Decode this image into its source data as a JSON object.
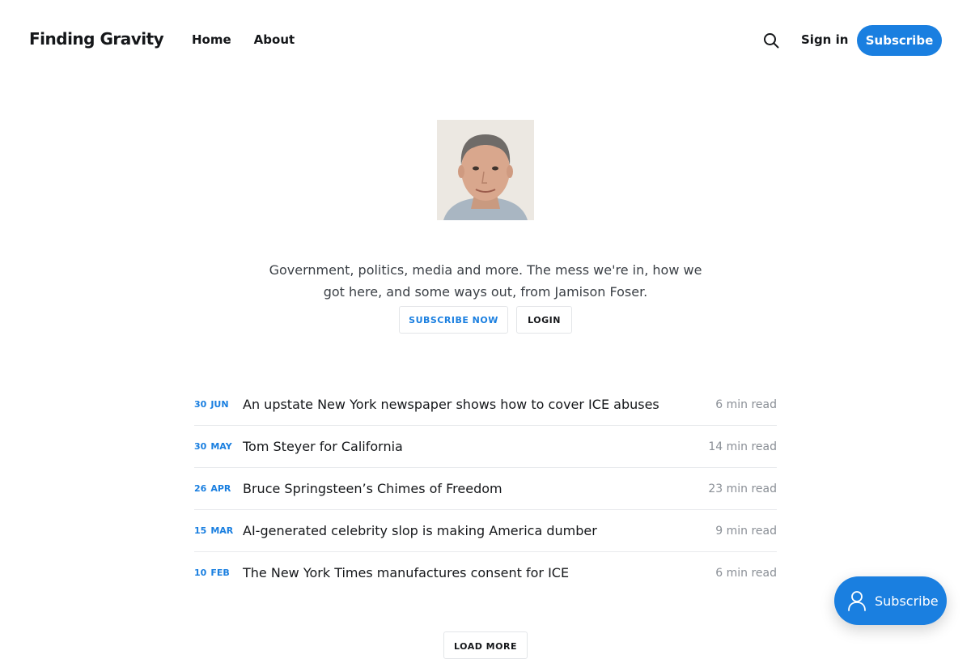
{
  "header": {
    "logo": "Finding Gravity",
    "nav": [
      {
        "label": "Home"
      },
      {
        "label": "About"
      }
    ],
    "search_icon": "search-icon",
    "signin_label": "Sign in",
    "subscribe_label": "Subscribe"
  },
  "hero": {
    "avatar": "author-photo",
    "description": "Government, politics, media and more. The mess we're in, how we got here, and some ways out, from Jamison Foser.",
    "subscribe_now_label": "SUBSCRIBE NOW",
    "login_label": "LOGIN"
  },
  "posts": [
    {
      "day": "30",
      "month": "JUN",
      "title": "An upstate New York newspaper shows how to cover ICE abuses",
      "read_time": "6 min read"
    },
    {
      "day": "30",
      "month": "MAY",
      "title": "Tom Steyer for California",
      "read_time": "14 min read"
    },
    {
      "day": "26",
      "month": "APR",
      "title": "Bruce Springsteen’s Chimes of Freedom",
      "read_time": "23 min read"
    },
    {
      "day": "15",
      "month": "MAR",
      "title": "AI-generated celebrity slop is making America dumber",
      "read_time": "9 min read"
    },
    {
      "day": "10",
      "month": "FEB",
      "title": "The New York Times manufactures consent for ICE",
      "read_time": "6 min read"
    }
  ],
  "load_more_label": "LOAD MORE",
  "portal": {
    "label": "Subscribe",
    "icon": "user-icon"
  },
  "colors": {
    "accent": "#1a7fe0",
    "text": "#15171a",
    "muted": "#8a8f96"
  }
}
